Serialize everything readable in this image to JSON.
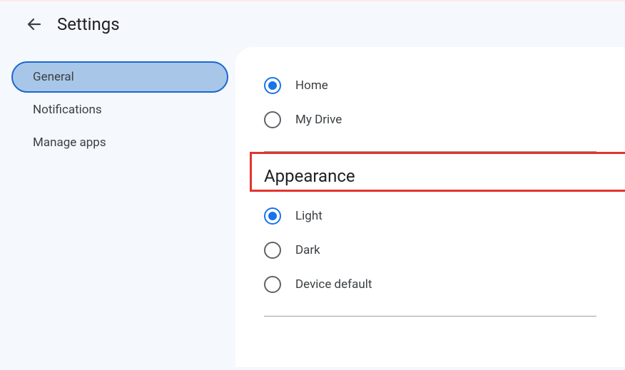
{
  "header": {
    "title": "Settings"
  },
  "sidebar": {
    "items": [
      {
        "label": "General",
        "active": true
      },
      {
        "label": "Notifications",
        "active": false
      },
      {
        "label": "Manage apps",
        "active": false
      }
    ]
  },
  "main": {
    "startGroup": {
      "options": [
        {
          "label": "Home",
          "checked": true
        },
        {
          "label": "My Drive",
          "checked": false
        }
      ]
    },
    "appearance": {
      "heading": "Appearance",
      "options": [
        {
          "label": "Light",
          "checked": true
        },
        {
          "label": "Dark",
          "checked": false
        },
        {
          "label": "Device default",
          "checked": false
        }
      ]
    }
  }
}
